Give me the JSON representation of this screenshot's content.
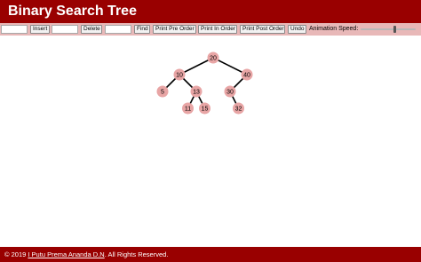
{
  "header": {
    "title": "Binary Search Tree"
  },
  "toolbar": {
    "insert_value": "",
    "insert_label": "Insert",
    "delete_value": "",
    "delete_label": "Delete",
    "find_value": "",
    "find_label": "Find",
    "preorder_label": "Print Pre Order",
    "inorder_label": "Print In Order",
    "postorder_label": "Print Post Order",
    "undo_label": "Undo",
    "speed_label": "Animation Speed:",
    "speed_fraction": 0.62
  },
  "tree": {
    "node_color": "#e8a5a5",
    "root": {
      "value": "20",
      "left": {
        "value": "10",
        "left": {
          "value": "5"
        },
        "right": {
          "value": "13",
          "left": {
            "value": "11"
          },
          "right": {
            "value": "15"
          }
        }
      },
      "right": {
        "value": "40",
        "left": {
          "value": "30",
          "right": {
            "value": "32"
          }
        }
      }
    }
  },
  "footer": {
    "prefix": "© 2019 ",
    "author": "I Putu Prema Ananda D.N",
    "suffix": ". All Rights Reserved."
  },
  "colors": {
    "header_bg": "#990000",
    "toolbar_bg": "#e8b8b8",
    "edge": "#000000"
  }
}
